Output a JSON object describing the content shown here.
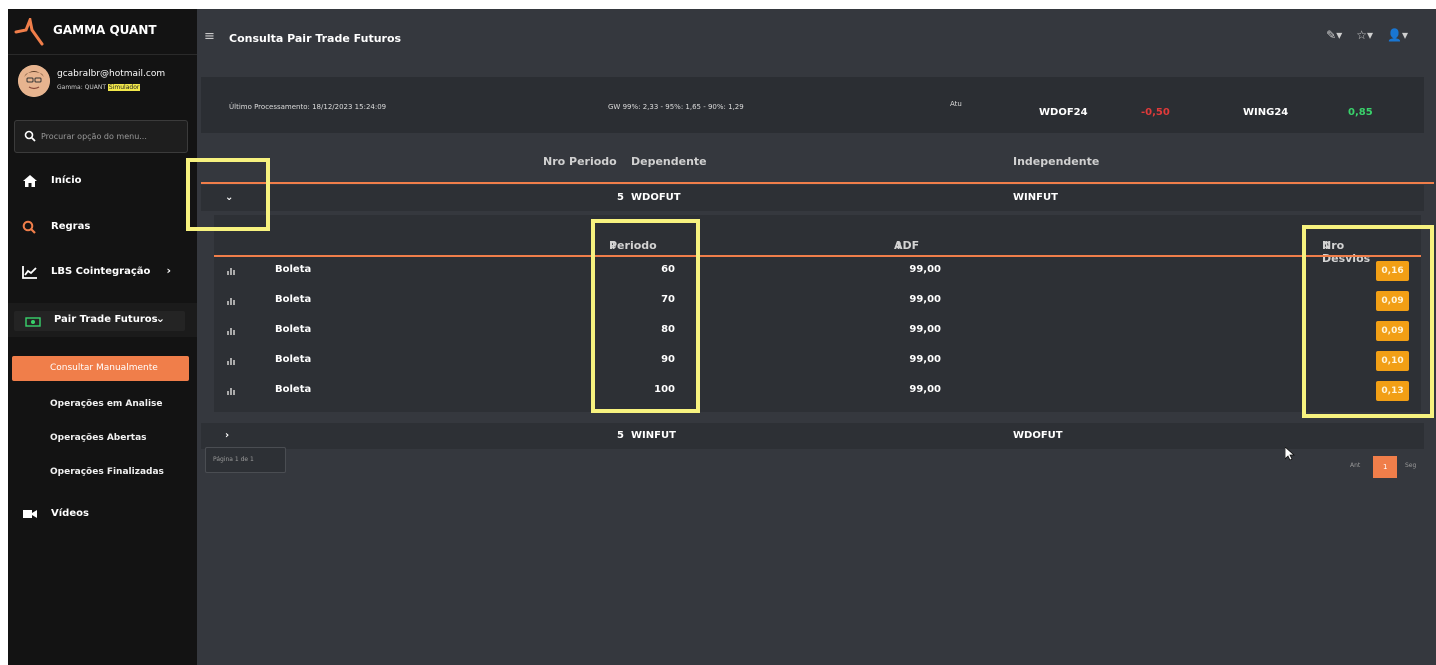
{
  "brand": {
    "name": "GAMMA QUANT"
  },
  "user": {
    "email": "gcabralbr@hotmail.com",
    "plan_prefix": "Gamma: QUANT",
    "plan_highlight": "Simulador"
  },
  "search": {
    "placeholder": "Procurar opção do menu..."
  },
  "nav": [
    {
      "label": "Início",
      "icon": "home-icon"
    },
    {
      "label": "Regras",
      "icon": "search-icon"
    },
    {
      "label": "LBS Cointegração",
      "icon": "chart-line-icon"
    },
    {
      "label": "Pair Trade Futuros",
      "icon": "money-icon"
    },
    {
      "label": "Vídeos",
      "icon": "video-icon"
    }
  ],
  "subnav": [
    {
      "label": "Consultar Manualmente",
      "active": true
    },
    {
      "label": "Operações em Analise"
    },
    {
      "label": "Operações Abertas"
    },
    {
      "label": "Operações Finalizadas"
    }
  ],
  "page": {
    "title": "Consulta Pair Trade Futuros"
  },
  "info": {
    "last_process": "Último Processamento: 18/12/2023 15:24:09",
    "gw": "GW 99%: 2,33 - 95%: 1,65 - 90%: 1,29",
    "atu": "Atu",
    "symbol1": "WDOF24",
    "value1": "-0,50",
    "symbol2": "WING24",
    "value2": "0,85"
  },
  "grid": {
    "headers": {
      "nro_periodo": "Nro Periodo",
      "dependente": "Dependente",
      "independente": "Independente"
    },
    "rows": [
      {
        "expand": "⌄",
        "nro_periodo": "5",
        "dependente": "WDOFUT",
        "independente": "WINFUT"
      },
      {
        "expand": "›",
        "nro_periodo": "5",
        "dependente": "WINFUT",
        "independente": "WDOFUT"
      }
    ]
  },
  "detail": {
    "headers": {
      "periodo": "Periodo",
      "periodo_sort": "↕",
      "adf": "ADF",
      "adf_sort": "↕",
      "desvios": "Nro Desvios",
      "desvios_sort": "↕"
    },
    "rows": [
      {
        "action": "Boleta",
        "periodo": "60",
        "adf": "99,00",
        "desvios": "0,16"
      },
      {
        "action": "Boleta",
        "periodo": "70",
        "adf": "99,00",
        "desvios": "0,09"
      },
      {
        "action": "Boleta",
        "periodo": "80",
        "adf": "99,00",
        "desvios": "0,09"
      },
      {
        "action": "Boleta",
        "periodo": "90",
        "adf": "99,00",
        "desvios": "0,10"
      },
      {
        "action": "Boleta",
        "periodo": "100",
        "adf": "99,00",
        "desvios": "0,13"
      }
    ]
  },
  "pager": {
    "info": "Página 1 de 1",
    "prev": "Ant",
    "current": "1",
    "next": "Seg"
  },
  "colors": {
    "accent": "#f07e4a",
    "badge": "#f29f15",
    "negative": "#e03a3a",
    "positive": "#39d26b",
    "highlight": "#f7f27f"
  }
}
